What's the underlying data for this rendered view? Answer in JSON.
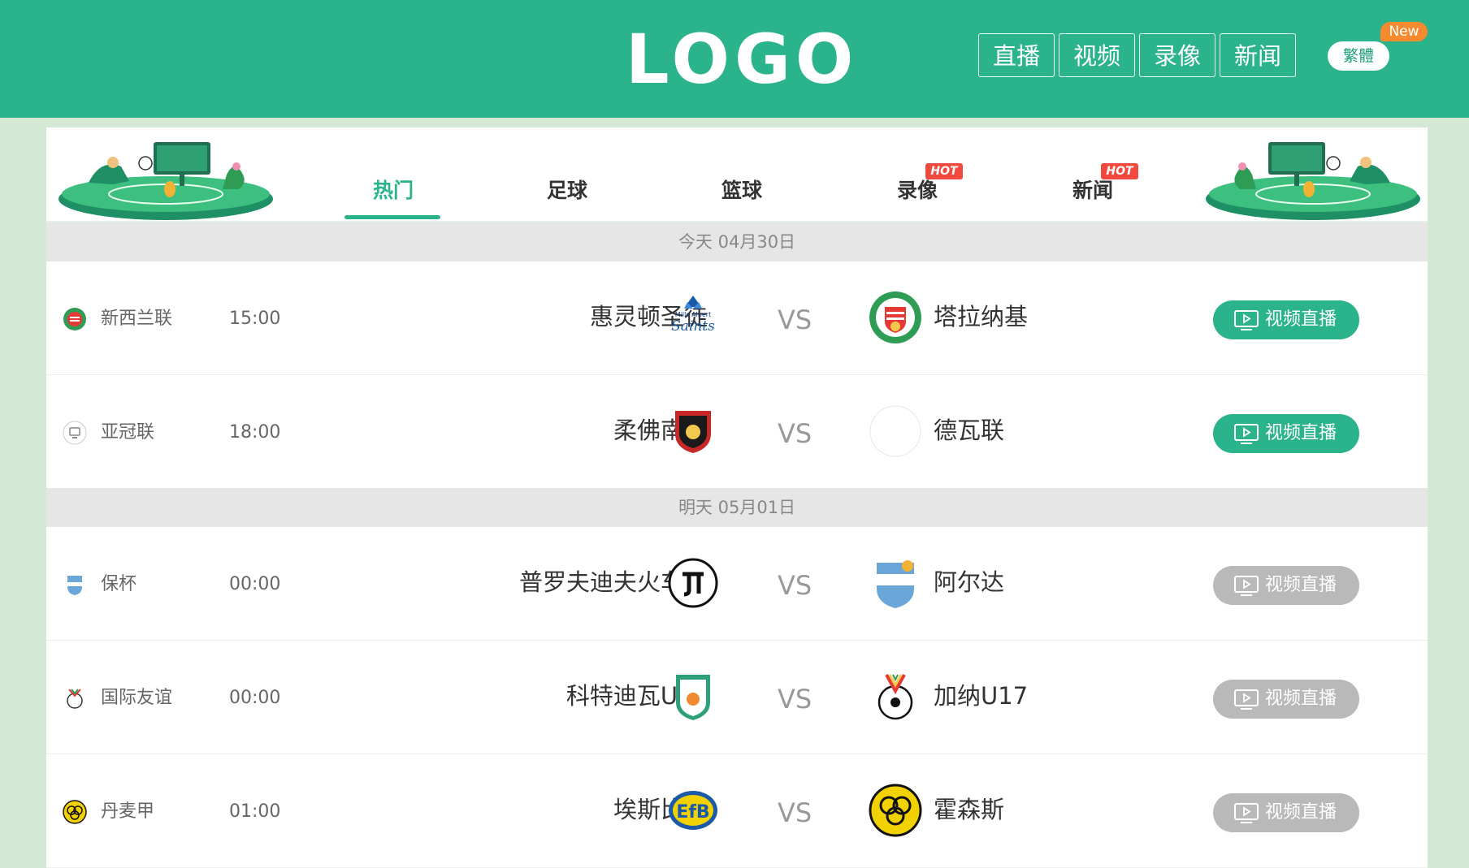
{
  "header": {
    "logo_text": "LOGO",
    "nav": [
      "直播",
      "视频",
      "录像",
      "新闻"
    ],
    "lang_label": "繁體",
    "new_badge": "New"
  },
  "tabs": [
    {
      "label": "热门",
      "active": true,
      "hot": false
    },
    {
      "label": "足球",
      "active": false,
      "hot": false
    },
    {
      "label": "篮球",
      "active": false,
      "hot": false
    },
    {
      "label": "录像",
      "active": false,
      "hot": true
    },
    {
      "label": "新闻",
      "active": false,
      "hot": true
    }
  ],
  "hot_badge": "HOT",
  "days": [
    {
      "date_label": "今天 04月30日",
      "matches": [
        {
          "league": "新西兰联",
          "time": "15:00",
          "home": "惠灵顿圣徒",
          "away": "塔拉纳基",
          "vs": "VS",
          "button": "视频直播",
          "live": true
        },
        {
          "league": "亚冠联",
          "time": "18:00",
          "home": "柔佛南虎",
          "away": "德瓦联",
          "vs": "VS",
          "button": "视频直播",
          "live": true
        }
      ]
    },
    {
      "date_label": "明天 05月01日",
      "matches": [
        {
          "league": "保杯",
          "time": "00:00",
          "home": "普罗夫迪夫火车头",
          "away": "阿尔达",
          "vs": "VS",
          "button": "视频直播",
          "live": false
        },
        {
          "league": "国际友谊",
          "time": "00:00",
          "home": "科特迪瓦U17",
          "away": "加纳U17",
          "vs": "VS",
          "button": "视频直播",
          "live": false
        },
        {
          "league": "丹麦甲",
          "time": "01:00",
          "home": "埃斯比约",
          "away": "霍森斯",
          "vs": "VS",
          "button": "视频直播",
          "live": false
        }
      ]
    }
  ],
  "colors": {
    "brand": "#2bb38b",
    "page_bg": "#d3e9d6",
    "hot": "#f04a3e",
    "new": "#f58a2e",
    "disabled": "#b9b9b9"
  },
  "icons": [
    "stadium-illustration",
    "tv-play-icon",
    "team-crest"
  ]
}
